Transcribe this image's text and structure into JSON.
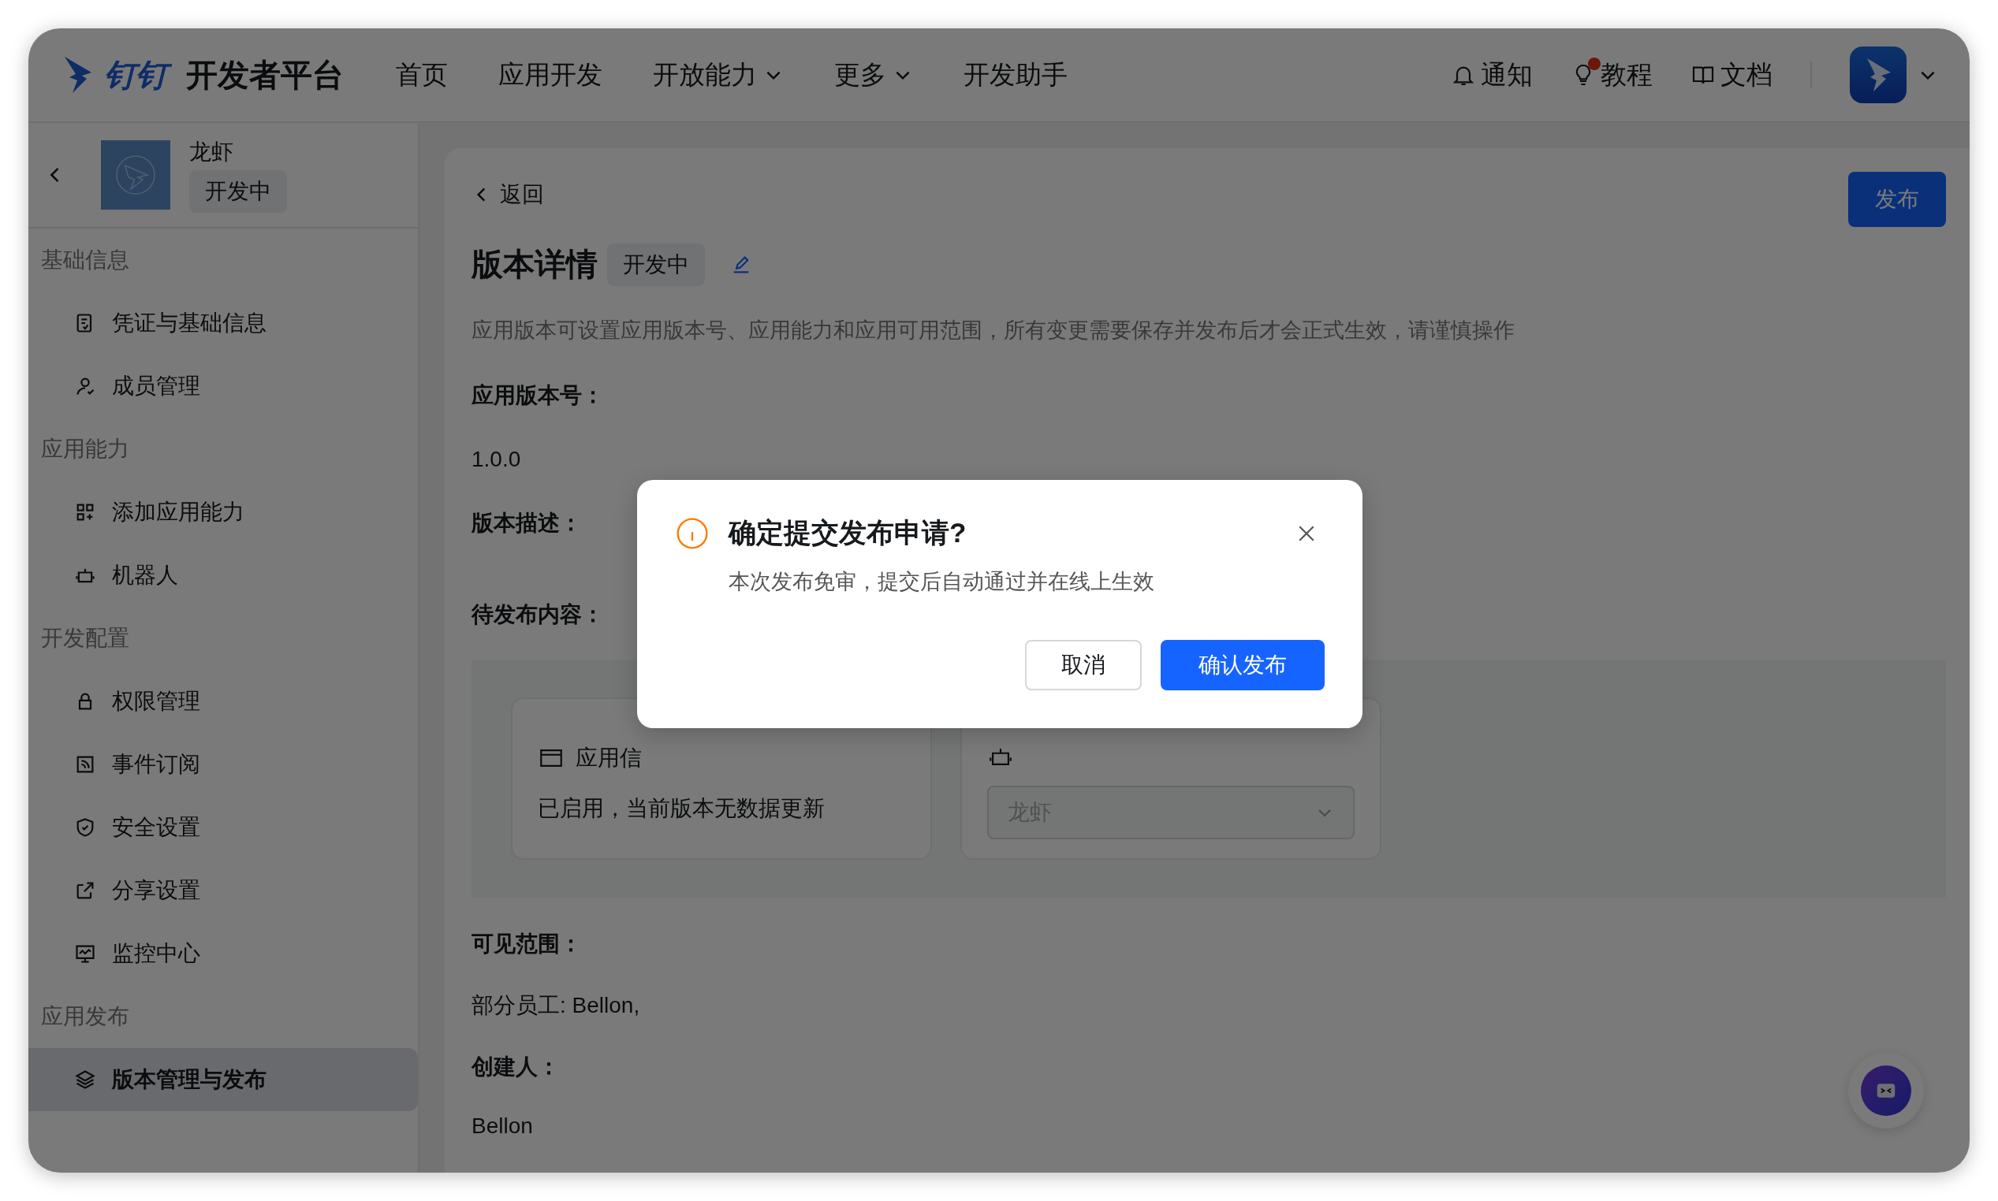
{
  "header": {
    "logo_text": "钉钉",
    "title": "开发者平台",
    "nav": [
      {
        "label": "首页",
        "has_menu": false
      },
      {
        "label": "应用开发",
        "has_menu": false
      },
      {
        "label": "开放能力",
        "has_menu": true
      },
      {
        "label": "更多",
        "has_menu": true
      },
      {
        "label": "开发助手",
        "has_menu": false
      }
    ],
    "actions": [
      {
        "label": "通知",
        "kind": "bell",
        "dot": false
      },
      {
        "label": "教程",
        "kind": "bulb",
        "dot": true
      },
      {
        "label": "文档",
        "kind": "book",
        "dot": false
      }
    ]
  },
  "sidebar": {
    "app": {
      "name": "龙虾",
      "status": "开发中"
    },
    "sections": [
      {
        "title": "基础信息",
        "items": [
          {
            "label": "凭证与基础信息",
            "kind": "credential",
            "selected": false
          },
          {
            "label": "成员管理",
            "kind": "member",
            "selected": false
          }
        ]
      },
      {
        "title": "应用能力",
        "items": [
          {
            "label": "添加应用能力",
            "kind": "grid",
            "selected": false
          },
          {
            "label": "机器人",
            "kind": "robot",
            "selected": false
          }
        ]
      },
      {
        "title": "开发配置",
        "items": [
          {
            "label": "权限管理",
            "kind": "lock",
            "selected": false
          },
          {
            "label": "事件订阅",
            "kind": "rss",
            "selected": false
          },
          {
            "label": "安全设置",
            "kind": "shield",
            "selected": false
          },
          {
            "label": "分享设置",
            "kind": "share",
            "selected": false
          },
          {
            "label": "监控中心",
            "kind": "monitor",
            "selected": false
          }
        ]
      },
      {
        "title": "应用发布",
        "items": [
          {
            "label": "版本管理与发布",
            "kind": "layers",
            "selected": true
          }
        ]
      }
    ]
  },
  "content": {
    "back": "返回",
    "publish_button": "发布",
    "title": "版本详情",
    "status": "开发中",
    "description": "应用版本可设置应用版本号、应用能力和应用可用范围，所有变更需要保存并发布后才会正式生效，请谨慎操作",
    "version": {
      "label": "应用版本号：",
      "value": "1.0.0"
    },
    "version_description": {
      "label": "版本描述："
    },
    "pending": {
      "label": "待发布内容：",
      "cards": [
        {
          "kind": "text",
          "title": "应用信",
          "text": "已启用，当前版本无数据更新"
        },
        {
          "kind": "select",
          "select": {
            "value": "龙虾",
            "disabled": true
          }
        }
      ]
    },
    "visibility": {
      "label": "可见范围：",
      "value": "部分员工: Bellon,"
    },
    "creator": {
      "label": "创建人：",
      "value": "Bellon"
    }
  },
  "dialog": {
    "title": "确定提交发布申请?",
    "message": "本次发布免审，提交后自动通过并在线上生效",
    "buttons": [
      {
        "label": "取消",
        "kind": "default"
      },
      {
        "label": "确认发布",
        "kind": "primary"
      }
    ]
  }
}
